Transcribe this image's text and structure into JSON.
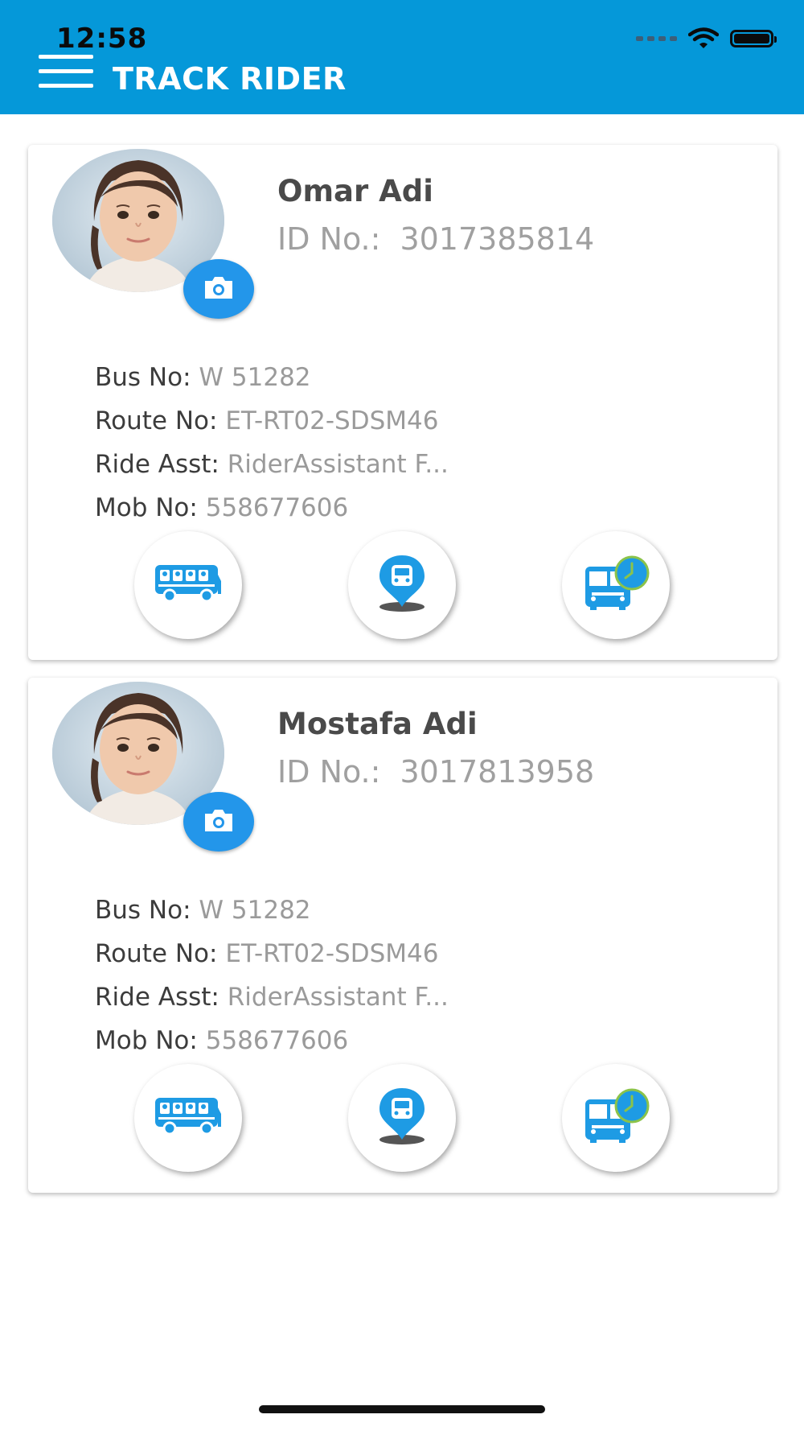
{
  "status_bar": {
    "time": "12:58"
  },
  "header": {
    "title": "TRACK RIDER",
    "menu_icon": "hamburger-menu-icon",
    "color": "#0598d9"
  },
  "riders": [
    {
      "name": "Omar Adi",
      "id_label": "ID No.:",
      "id_value": "3017385814",
      "fields": [
        {
          "label": "Bus No:",
          "value": "W 51282"
        },
        {
          "label": "Route No:",
          "value": "ET-RT02-SDSM46"
        },
        {
          "label": "Ride Asst:",
          "value": "RiderAssistant F..."
        },
        {
          "label": "Mob No:",
          "value": "558677606"
        }
      ],
      "actions": [
        "bus-riders-icon",
        "bus-location-pin-icon",
        "bus-schedule-clock-icon"
      ]
    },
    {
      "name": "Mostafa Adi",
      "id_label": "ID No.:",
      "id_value": "3017813958",
      "fields": [
        {
          "label": "Bus No:",
          "value": "W 51282"
        },
        {
          "label": "Route No:",
          "value": "ET-RT02-SDSM46"
        },
        {
          "label": "Ride Asst:",
          "value": "RiderAssistant F..."
        },
        {
          "label": "Mob No:",
          "value": "558677606"
        }
      ],
      "actions": [
        "bus-riders-icon",
        "bus-location-pin-icon",
        "bus-schedule-clock-icon"
      ]
    }
  ],
  "colors": {
    "accent": "#2396ea",
    "icon_blue": "#1e9be4",
    "clock_green": "#8bc34a"
  }
}
